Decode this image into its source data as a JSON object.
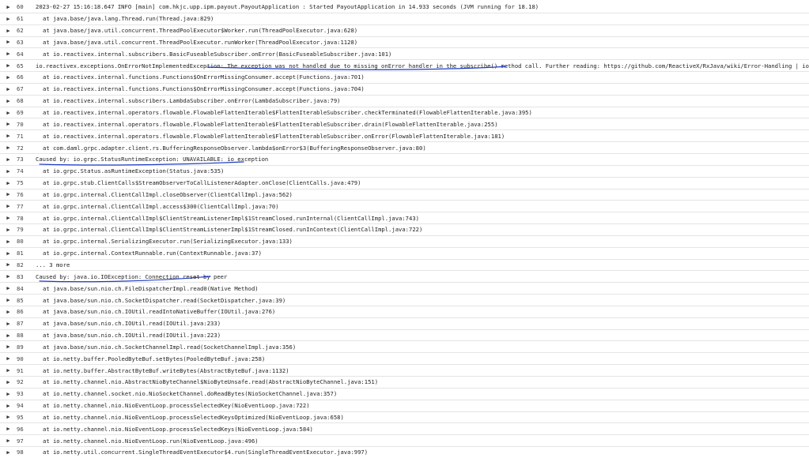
{
  "toggle_glyph": "▶",
  "colors": {
    "annotation_ink": "#1f3cc4",
    "row_divider": "#e4e4e4"
  },
  "rows": [
    {
      "line": "60",
      "text": "2023-02-27 15:16:18.647 INFO [main] com.hkjc.upp.ipm.payout.PayoutApplication : Started PayoutApplication in 14.933 seconds (JVM running for 18.18)",
      "indent": false
    },
    {
      "line": "61",
      "text": "at java.base/java.lang.Thread.run(Thread.java:829)",
      "indent": true
    },
    {
      "line": "62",
      "text": "at java.base/java.util.concurrent.ThreadPoolExecutor$Worker.run(ThreadPoolExecutor.java:628)",
      "indent": true
    },
    {
      "line": "63",
      "text": "at java.base/java.util.concurrent.ThreadPoolExecutor.runWorker(ThreadPoolExecutor.java:1128)",
      "indent": true
    },
    {
      "line": "64",
      "text": "at io.reactivex.internal.subscribers.BasicFuseableSubscriber.onError(BasicFuseableSubscriber.java:101)",
      "indent": true
    },
    {
      "line": "65",
      "text": "io.reactivex.exceptions.OnErrorNotImplementedException: The exception was not handled due to missing onError handler in the subscribe() method call. Further reading: https://github.com/ReactiveX/RxJava/wiki/Error-Handling | io.grpc.StatusRuntimeException: UNA...",
      "indent": false
    },
    {
      "line": "66",
      "text": "at io.reactivex.internal.functions.Functions$OnErrorMissingConsumer.accept(Functions.java:701)",
      "indent": true
    },
    {
      "line": "67",
      "text": "at io.reactivex.internal.functions.Functions$OnErrorMissingConsumer.accept(Functions.java:704)",
      "indent": true
    },
    {
      "line": "68",
      "text": "at io.reactivex.internal.subscribers.LambdaSubscriber.onError(LambdaSubscriber.java:79)",
      "indent": true
    },
    {
      "line": "69",
      "text": "at io.reactivex.internal.operators.flowable.FlowableFlattenIterable$FlattenIterableSubscriber.checkTerminated(FlowableFlattenIterable.java:395)",
      "indent": true
    },
    {
      "line": "70",
      "text": "at io.reactivex.internal.operators.flowable.FlowableFlattenIterable$FlattenIterableSubscriber.drain(FlowableFlattenIterable.java:255)",
      "indent": true
    },
    {
      "line": "71",
      "text": "at io.reactivex.internal.operators.flowable.FlowableFlattenIterable$FlattenIterableSubscriber.onError(FlowableFlattenIterable.java:181)",
      "indent": true
    },
    {
      "line": "72",
      "text": "at com.daml.grpc.adapter.client.rs.BufferingResponseObserver.lambda$onError$3(BufferingResponseObserver.java:80)",
      "indent": true
    },
    {
      "line": "73",
      "text": "Caused by: io.grpc.StatusRuntimeException: UNAVAILABLE: io exception",
      "indent": false
    },
    {
      "line": "74",
      "text": "at io.grpc.Status.asRuntimeException(Status.java:535)",
      "indent": true
    },
    {
      "line": "75",
      "text": "at io.grpc.stub.ClientCalls$StreamObserverToCallListenerAdapter.onClose(ClientCalls.java:479)",
      "indent": true
    },
    {
      "line": "76",
      "text": "at io.grpc.internal.ClientCallImpl.closeObserver(ClientCallImpl.java:562)",
      "indent": true
    },
    {
      "line": "77",
      "text": "at io.grpc.internal.ClientCallImpl.access$300(ClientCallImpl.java:70)",
      "indent": true
    },
    {
      "line": "78",
      "text": "at io.grpc.internal.ClientCallImpl$ClientStreamListenerImpl$1StreamClosed.runInternal(ClientCallImpl.java:743)",
      "indent": true
    },
    {
      "line": "79",
      "text": "at io.grpc.internal.ClientCallImpl$ClientStreamListenerImpl$1StreamClosed.runInContext(ClientCallImpl.java:722)",
      "indent": true
    },
    {
      "line": "80",
      "text": "at io.grpc.internal.SerializingExecutor.run(SerializingExecutor.java:133)",
      "indent": true
    },
    {
      "line": "81",
      "text": "at io.grpc.internal.ContextRunnable.run(ContextRunnable.java:37)",
      "indent": true
    },
    {
      "line": "82",
      "text": "... 3 more",
      "indent": false
    },
    {
      "line": "83",
      "text": "Caused by: java.io.IOException: Connection reset by peer",
      "indent": false
    },
    {
      "line": "84",
      "text": "at java.base/sun.nio.ch.FileDispatcherImpl.read0(Native Method)",
      "indent": true
    },
    {
      "line": "85",
      "text": "at java.base/sun.nio.ch.SocketDispatcher.read(SocketDispatcher.java:39)",
      "indent": true
    },
    {
      "line": "86",
      "text": "at java.base/sun.nio.ch.IOUtil.readIntoNativeBuffer(IOUtil.java:276)",
      "indent": true
    },
    {
      "line": "87",
      "text": "at java.base/sun.nio.ch.IOUtil.read(IOUtil.java:233)",
      "indent": true
    },
    {
      "line": "88",
      "text": "at java.base/sun.nio.ch.IOUtil.read(IOUtil.java:223)",
      "indent": true
    },
    {
      "line": "89",
      "text": "at java.base/sun.nio.ch.SocketChannelImpl.read(SocketChannelImpl.java:356)",
      "indent": true
    },
    {
      "line": "90",
      "text": "at io.netty.buffer.PooledByteBuf.setBytes(PooledByteBuf.java:258)",
      "indent": true
    },
    {
      "line": "91",
      "text": "at io.netty.buffer.AbstractByteBuf.writeBytes(AbstractByteBuf.java:1132)",
      "indent": true
    },
    {
      "line": "92",
      "text": "at io.netty.channel.nio.AbstractNioByteChannel$NioByteUnsafe.read(AbstractNioByteChannel.java:151)",
      "indent": true
    },
    {
      "line": "93",
      "text": "at io.netty.channel.socket.nio.NioSocketChannel.doReadBytes(NioSocketChannel.java:357)",
      "indent": true
    },
    {
      "line": "94",
      "text": "at io.netty.channel.nio.NioEventLoop.processSelectedKey(NioEventLoop.java:722)",
      "indent": true
    },
    {
      "line": "95",
      "text": "at io.netty.channel.nio.NioEventLoop.processSelectedKeysOptimized(NioEventLoop.java:658)",
      "indent": true
    },
    {
      "line": "96",
      "text": "at io.netty.channel.nio.NioEventLoop.processSelectedKeys(NioEventLoop.java:584)",
      "indent": true
    },
    {
      "line": "97",
      "text": "at io.netty.channel.nio.NioEventLoop.run(NioEventLoop.java:496)",
      "indent": true
    },
    {
      "line": "98",
      "text": "at io.netty.util.concurrent.SingleThreadEventExecutor$4.run(SingleThreadEventExecutor.java:997)",
      "indent": true
    }
  ]
}
